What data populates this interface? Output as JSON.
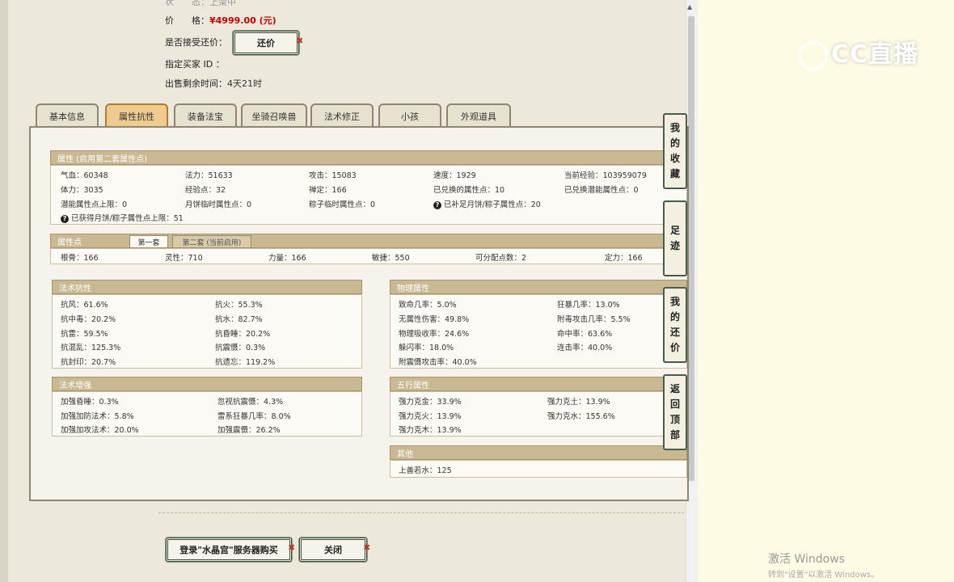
{
  "info": {
    "top_partial": "状　　态：上架中",
    "price_label": "价　　格：",
    "price_value": "¥4999.00 (元)",
    "bargain_label": "是否接受还价：",
    "bargain_button": "还价",
    "buyer_label": "指定买家 ID ：",
    "remaining_label": "出售剩余时间：",
    "remaining_value": "4天21时"
  },
  "tabs": [
    "基本信息",
    "属性抗性",
    "装备法宝",
    "坐骑召唤兽",
    "法术修正",
    "小孩",
    "外观道具"
  ],
  "attr": {
    "header": "属性 (启用第二套属性点)",
    "row1": [
      "气血：60348",
      "法力：51633",
      "攻击：15083",
      "速度：1929",
      "当前经验：103959079"
    ],
    "row2": [
      "体力：3035",
      "经验点：32",
      "禅定：166",
      "已兑换的属性点：10",
      "已兑换潜能属性点：0"
    ],
    "row3": [
      "潜能属性点上限：0",
      "月饼临时属性点：0",
      "粽子临时属性点：0",
      "已补足月饼/粽子属性点：20"
    ],
    "row4": "已获得月饼/粽子属性点上限：51"
  },
  "points": {
    "header": "属性点",
    "tab1": "第一套",
    "tab2": "第二套 (当前启用)",
    "row": [
      "根骨：166",
      "灵性：710",
      "力量：166",
      "敏捷：550",
      "可分配点数：2",
      "定力：166"
    ]
  },
  "magic_resist": {
    "header": "法术抗性",
    "left": [
      "抗风：61.6%",
      "抗中毒：20.2%",
      "抗雷：59.5%",
      "抗混乱：125.3%",
      "抗封印：20.7%"
    ],
    "right": [
      "抗火：55.3%",
      "抗水：82.7%",
      "抗昏睡：20.2%",
      "抗震慑：0.3%",
      "抗遗忘：119.2%"
    ]
  },
  "physical": {
    "header": "物理属性",
    "left": [
      "致命几率：5.0%",
      "无属性伤害：49.8%",
      "物理吸收率：24.6%",
      "躲闪率：18.0%",
      "附震慑攻击率：40.0%"
    ],
    "right": [
      "狂暴几率：13.0%",
      "附毒攻击几率：5.5%",
      "命中率：63.6%",
      "连击率：40.0%"
    ]
  },
  "magic_boost": {
    "header": "法术增强",
    "left": [
      "加强昏睡：0.3%",
      "加强加防法术：5.8%",
      "加强加攻法术：20.0%"
    ],
    "right": [
      "忽视抗震慑：4.3%",
      "雷系狂暴几率：8.0%",
      "加强震慑：26.2%"
    ]
  },
  "five": {
    "header": "五行属性",
    "left": [
      "强力克金：33.9%",
      "强力克火：13.9%",
      "强力克木：13.9%"
    ],
    "right": [
      "强力克土：13.9%",
      "强力克水：155.6%"
    ]
  },
  "other": {
    "header": "其他",
    "item": "上善若水：125"
  },
  "side": {
    "favorites": [
      "我",
      "的",
      "收",
      "藏"
    ],
    "footprint": [
      "足",
      "迹"
    ],
    "my_bargain": [
      "我",
      "的",
      "还",
      "价"
    ],
    "top": [
      "返",
      "回",
      "顶",
      "部"
    ]
  },
  "bottom": {
    "login_button": "登录\"水晶宫\"服务器购买",
    "close_button": "关闭"
  },
  "watermark": "CC直播",
  "windows": {
    "title": "激活 Windows",
    "sub": "转到\"设置\"以激活 Windows。"
  }
}
